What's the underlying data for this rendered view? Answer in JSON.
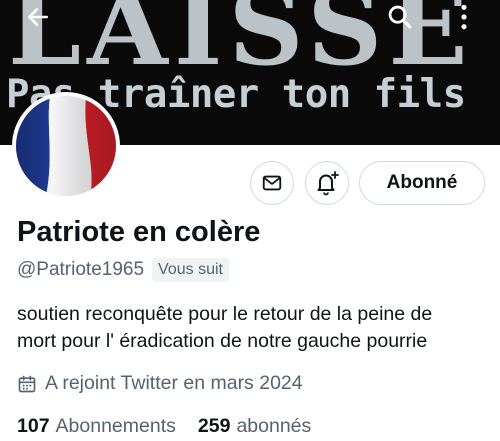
{
  "banner": {
    "headline": "LAISSE",
    "subline": "Pas traîner ton fils"
  },
  "nav": {
    "back_icon": "arrow-left-icon",
    "search_icon": "search-icon",
    "more_icon": "more-vertical-icon"
  },
  "actions": {
    "message_icon": "envelope-icon",
    "notify_icon": "bell-plus-icon",
    "follow_label": "Abonné"
  },
  "profile": {
    "display_name": "Patriote en colère",
    "handle": "@Patriote1965",
    "follows_you": "Vous suit",
    "bio_line1": "soutien reconquête pour le retour de la peine de",
    "bio_line2": "mort pour l' éradication de notre gauche pourrie",
    "joined": "A rejoint Twitter en mars 2024",
    "following_count": "107",
    "following_label": "Abonnements",
    "followers_count": "259",
    "followers_label": "abonnés"
  },
  "colors": {
    "text_primary": "#0f1419",
    "text_secondary": "#536471",
    "border": "#cfd9de",
    "flag_blue": "#1f3a93",
    "flag_red": "#d4202a"
  }
}
